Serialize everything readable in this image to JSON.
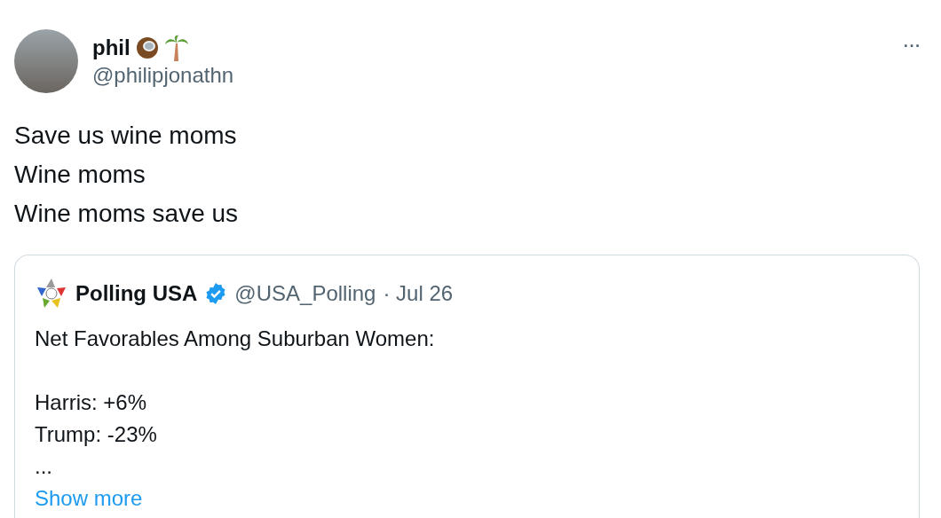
{
  "author": {
    "name": "phil",
    "handle": "@philipjonathn"
  },
  "more": "···",
  "body": [
    "Save us wine moms",
    "Wine moms",
    "Wine moms save us"
  ],
  "quote": {
    "name": "Polling USA",
    "verified": true,
    "handle": "@USA_Polling",
    "date": "· Jul 26",
    "paragraphs": [
      [
        "Net Favorables Among Suburban Women:"
      ],
      [
        "Harris: +6%",
        "Trump: -23%",
        "..."
      ]
    ],
    "show_more": "Show more"
  }
}
